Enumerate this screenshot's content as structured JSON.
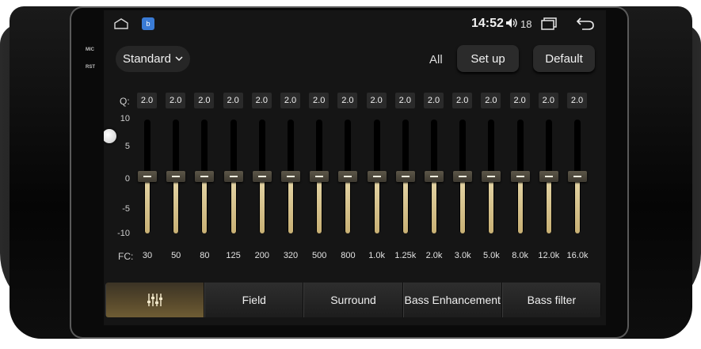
{
  "status_bar": {
    "time": "14:52",
    "volume": "18",
    "icons": [
      "home-icon",
      "app-icon",
      "volume-icon",
      "recent-apps-icon",
      "back-icon"
    ]
  },
  "side_labels": {
    "mic": "MIC",
    "rst": "RST"
  },
  "controls": {
    "preset": "Standard",
    "all_label": "All",
    "setup_label": "Set up",
    "default_label": "Default"
  },
  "eq": {
    "q_label": "Q:",
    "fc_label": "FC:",
    "scale": [
      "10",
      "5",
      "0",
      "-5",
      "-10"
    ],
    "bands": [
      {
        "q": "2.0",
        "fc": "30",
        "gain": 0
      },
      {
        "q": "2.0",
        "fc": "50",
        "gain": 0
      },
      {
        "q": "2.0",
        "fc": "80",
        "gain": 0
      },
      {
        "q": "2.0",
        "fc": "125",
        "gain": 0
      },
      {
        "q": "2.0",
        "fc": "200",
        "gain": 0
      },
      {
        "q": "2.0",
        "fc": "320",
        "gain": 0
      },
      {
        "q": "2.0",
        "fc": "500",
        "gain": 0
      },
      {
        "q": "2.0",
        "fc": "800",
        "gain": 0
      },
      {
        "q": "2.0",
        "fc": "1.0k",
        "gain": 0
      },
      {
        "q": "2.0",
        "fc": "1.25k",
        "gain": 0
      },
      {
        "q": "2.0",
        "fc": "2.0k",
        "gain": 0
      },
      {
        "q": "2.0",
        "fc": "3.0k",
        "gain": 0
      },
      {
        "q": "2.0",
        "fc": "5.0k",
        "gain": 0
      },
      {
        "q": "2.0",
        "fc": "8.0k",
        "gain": 0
      },
      {
        "q": "2.0",
        "fc": "12.0k",
        "gain": 0
      },
      {
        "q": "2.0",
        "fc": "16.0k",
        "gain": 0
      }
    ]
  },
  "tabs": [
    {
      "label": "",
      "icon": "equalizer-icon",
      "active": true
    },
    {
      "label": "Field",
      "active": false
    },
    {
      "label": "Surround",
      "active": false
    },
    {
      "label": "Bass Enhancement",
      "active": false
    },
    {
      "label": "Bass filter",
      "active": false
    }
  ],
  "colors": {
    "slider_fill": "#d9c796",
    "active_tab": "#5a4b2c",
    "screen_bg": "#151515"
  }
}
